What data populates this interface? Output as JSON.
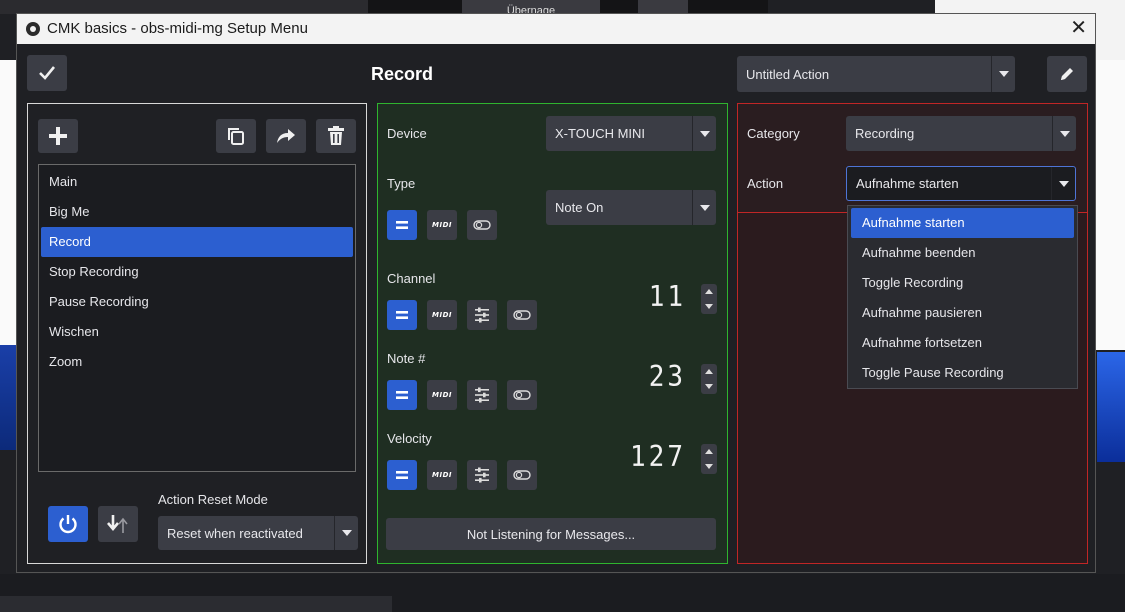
{
  "window": {
    "title": "CMK basics - obs-midi-mg Setup Menu",
    "close_glyph": "✕"
  },
  "header": {
    "page_title": "Record",
    "action_name": "Untitled Action"
  },
  "background": {
    "top_tab_text": "Übernage"
  },
  "left_panel": {
    "actions": [
      {
        "label": "Main",
        "selected": false
      },
      {
        "label": "Big Me",
        "selected": false
      },
      {
        "label": "Record",
        "selected": true
      },
      {
        "label": "Stop Recording",
        "selected": false
      },
      {
        "label": "Pause Recording",
        "selected": false
      },
      {
        "label": "Wischen",
        "selected": false
      },
      {
        "label": "Zoom",
        "selected": false
      }
    ],
    "reset_mode_label": "Action Reset Mode",
    "reset_mode_value": "Reset when reactivated"
  },
  "middle_panel": {
    "device_label": "Device",
    "device_value": "X-TOUCH MINI",
    "type_label": "Type",
    "type_value": "Note On",
    "channel_label": "Channel",
    "channel_value": "11",
    "note_label": "Note #",
    "note_value": "23",
    "velocity_label": "Velocity",
    "velocity_value": "127",
    "midi_icon_text": "MIDI",
    "listen_button_label": "Not Listening for Messages..."
  },
  "right_panel": {
    "category_label": "Category",
    "category_value": "Recording",
    "action_label": "Action",
    "action_value": "Aufnahme starten",
    "action_options": [
      {
        "label": "Aufnahme starten",
        "selected": true
      },
      {
        "label": "Aufnahme beenden",
        "selected": false
      },
      {
        "label": "Toggle Recording",
        "selected": false
      },
      {
        "label": "Aufnahme pausieren",
        "selected": false
      },
      {
        "label": "Aufnahme fortsetzen",
        "selected": false
      },
      {
        "label": "Toggle Pause Recording",
        "selected": false
      }
    ]
  },
  "colors": {
    "accent_blue": "#2c5fd0",
    "mid_panel_border": "#2fb42f",
    "right_panel_border": "#c02626"
  }
}
